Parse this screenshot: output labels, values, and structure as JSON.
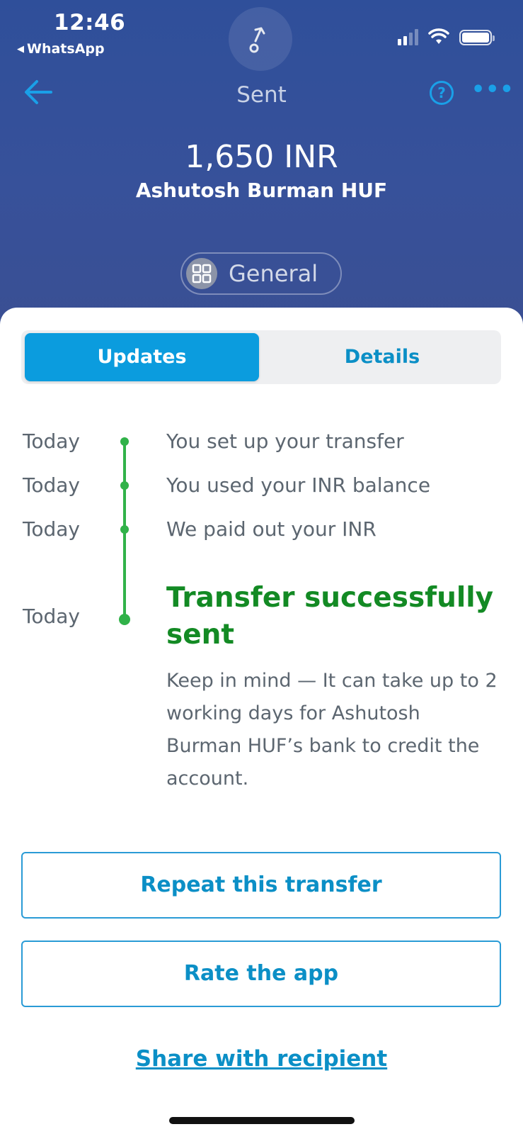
{
  "status_bar": {
    "time": "12:46",
    "back_app": "WhatsApp",
    "back_glyph": "◀"
  },
  "nav": {
    "title": "Sent",
    "help_glyph": "?",
    "more_glyph": "•••"
  },
  "transfer": {
    "amount": "1,650 INR",
    "recipient": "Ashutosh Burman HUF",
    "category": "General"
  },
  "tabs": [
    {
      "label": "Updates",
      "active": true
    },
    {
      "label": "Details",
      "active": false
    }
  ],
  "timeline": [
    {
      "date": "Today",
      "text": "You set up your transfer"
    },
    {
      "date": "Today",
      "text": "You used your INR balance"
    },
    {
      "date": "Today",
      "text": "We paid out your INR"
    },
    {
      "date": "Today",
      "text": "Transfer successfully sent",
      "note": "Keep in mind — It can take up to 2 working days for Ashutosh Burman HUF’s bank to credit the account."
    }
  ],
  "actions": {
    "repeat": "Repeat this transfer",
    "rate": "Rate the app",
    "share": "Share with recipient"
  },
  "colors": {
    "header_bg": "#34509a",
    "accent": "#0b9cde",
    "success": "#138a24",
    "timeline": "#31b249"
  }
}
